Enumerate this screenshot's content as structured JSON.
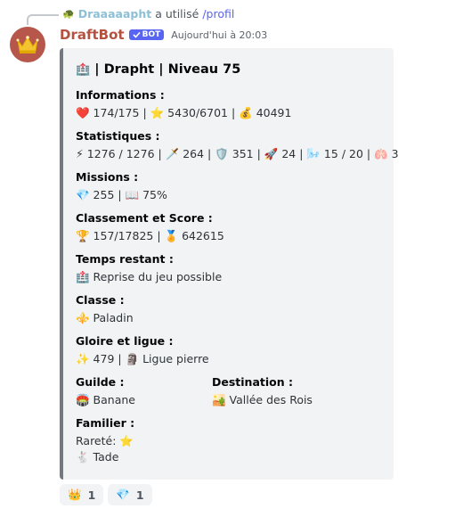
{
  "reply": {
    "icon": "🐢",
    "username": "Draaaaapht",
    "action": "a utilisé",
    "command": "/profil"
  },
  "message": {
    "author": "DraftBot",
    "bot_tag": "BOT",
    "timestamp": "Aujourd'hui à 20:03"
  },
  "embed": {
    "title_icon": "🏥",
    "title": "| Drapht | Niveau 75",
    "fields": {
      "informations": {
        "name": "Informations :",
        "value": "❤️ 174/175 | ⭐ 5430/6701 | 💰 40491"
      },
      "statistiques": {
        "name": "Statistiques :",
        "value": "⚡ 1276 / 1276 | 🗡️ 264 | 🛡️ 351 | 🚀 24 | 🌬️ 15 / 20 | 🫁 3"
      },
      "missions": {
        "name": "Missions :",
        "value": "💎 255 | 📖 75%"
      },
      "classement": {
        "name": "Classement et Score :",
        "value": "🏆 157/17825 | 🏅 642615"
      },
      "temps": {
        "name": "Temps restant :",
        "value": "🏥 Reprise du jeu possible"
      },
      "classe": {
        "name": "Classe :",
        "value": "⚜️ Paladin"
      },
      "gloire": {
        "name": "Gloire et ligue :",
        "value": "✨ 479 | 🗿 Ligue pierre"
      },
      "guilde": {
        "name": "Guilde :",
        "value": "🏟️ Banane"
      },
      "destination": {
        "name": "Destination :",
        "value": "🏜️ Vallée des Rois"
      },
      "familier": {
        "name": "Familier :",
        "rarity": "Rareté: ⭐",
        "pet": "🐇 Tade"
      }
    }
  },
  "reactions": [
    {
      "emoji": "👑",
      "count": "1"
    },
    {
      "emoji": "💎",
      "count": "1"
    }
  ]
}
